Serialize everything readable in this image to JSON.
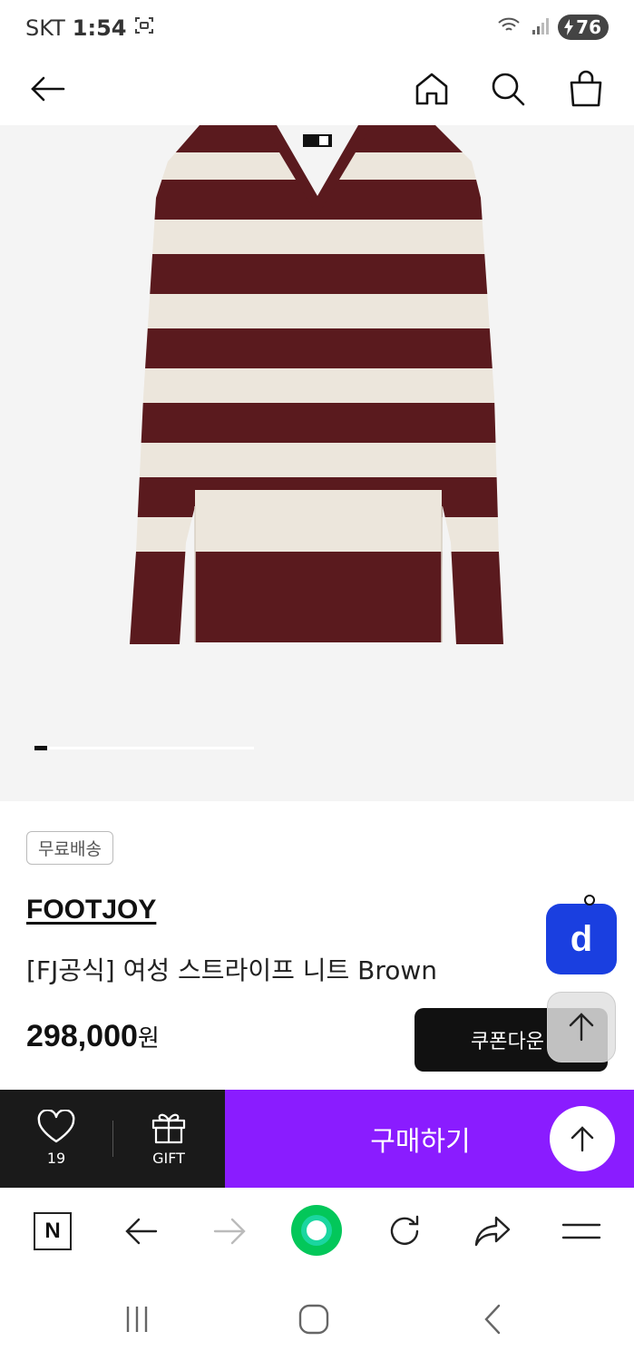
{
  "status_bar": {
    "carrier": "SKT",
    "time": "1:54",
    "battery": "76"
  },
  "header": {
    "back_icon": "arrow-left-icon",
    "home_icon": "home-icon",
    "search_icon": "search-icon",
    "cart_icon": "shopping-bag-icon"
  },
  "product": {
    "image_colors": {
      "stripe_dark": "#5a1a1e",
      "stripe_light": "#ece6dc"
    },
    "carousel_position": {
      "current": 1
    },
    "badge": "무료배송",
    "brand": "FOOTJOY",
    "title": "[FJ공식] 여성 스트라이프 니트 Brown",
    "price": "298,000",
    "price_unit": "원",
    "coupon_label": "쿠폰다운"
  },
  "floating": {
    "d_label": "d",
    "scroll_top_icon": "arrow-up-icon"
  },
  "buy_bar": {
    "wish_count": "19",
    "gift_label": "GIFT",
    "buy_label": "구매하기",
    "accent_color": "#8a1cff"
  },
  "browser_bar": {
    "n_label": "N",
    "icons": [
      "naver-icon",
      "back-icon",
      "forward-icon",
      "green-dot-icon",
      "refresh-icon",
      "share-icon",
      "menu-icon"
    ]
  },
  "android_nav": {
    "icons": [
      "recents-icon",
      "home-icon",
      "back-icon"
    ]
  }
}
